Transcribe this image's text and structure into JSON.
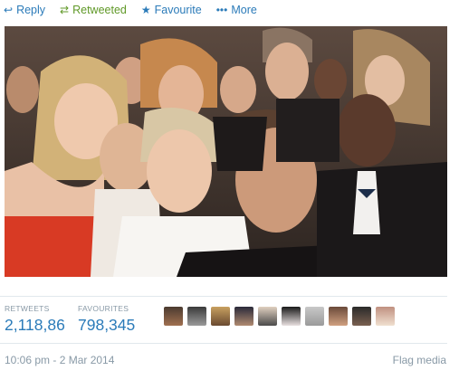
{
  "actions": {
    "reply": {
      "icon": "reply-icon",
      "label": "Reply"
    },
    "retweet": {
      "icon": "retweet-icon",
      "label": "Retweeted"
    },
    "favourite": {
      "icon": "star-icon",
      "label": "Favourite"
    },
    "more": {
      "icon": "more-dots-icon",
      "label": "More"
    }
  },
  "colors": {
    "link": "#2b7bb9",
    "retweeted": "#609928",
    "muted": "#8899a6"
  },
  "stats": {
    "retweets_label": "RETWEETS",
    "retweets_value": "2,118,86",
    "favourites_label": "FAVOURITES",
    "favourites_value": "798,345"
  },
  "avatars": [
    "user-avatar-1",
    "user-avatar-2",
    "user-avatar-3",
    "user-avatar-4",
    "user-avatar-5",
    "user-avatar-6",
    "user-avatar-7",
    "user-avatar-8",
    "user-avatar-9",
    "user-avatar-10"
  ],
  "footer": {
    "timestamp": "10:06 pm - 2 Mar 2014",
    "flag_label": "Flag media"
  }
}
